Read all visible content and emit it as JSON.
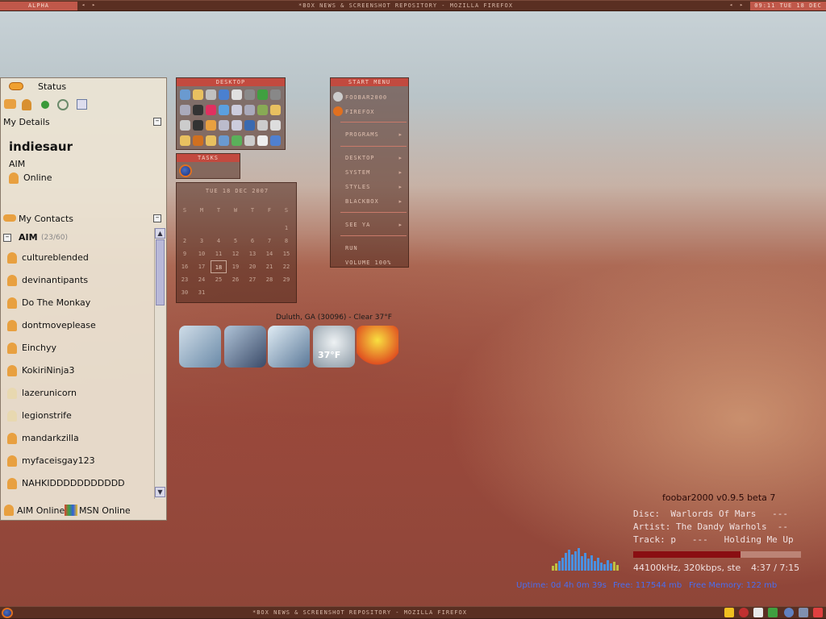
{
  "topbar": {
    "workspace": "ALPHA",
    "title": "*BOX NEWS & SCREENSHOT REPOSITORY - MOZILLA FIREFOX",
    "clock": "09:11 TUE 18 DEC",
    "prev": "◂",
    "next": "▸"
  },
  "bottombar": {
    "title": "*BOX NEWS & SCREENSHOT REPOSITORY - MOZILLA FIREFOX"
  },
  "im": {
    "status_label": "Status",
    "my_details": "My Details",
    "screen_name": "indiesaur",
    "protocol": "AIM",
    "online_status": "Online",
    "my_contacts": "My Contacts",
    "group_name": "AIM",
    "group_count": "(23/60)",
    "contacts": [
      {
        "name": "cultureblended",
        "away": false
      },
      {
        "name": "devinantipants",
        "away": false
      },
      {
        "name": "Do The Monkay",
        "away": false
      },
      {
        "name": "dontmoveplease",
        "away": false
      },
      {
        "name": "Einchyy",
        "away": false
      },
      {
        "name": "KokiriNinja3",
        "away": false
      },
      {
        "name": "lazerunicorn",
        "away": true
      },
      {
        "name": "legionstrife",
        "away": true
      },
      {
        "name": "mandarkzilla",
        "away": false
      },
      {
        "name": "myfaceisgay123",
        "away": false
      },
      {
        "name": "NAHKIDDDDDDDDDDD",
        "away": false
      }
    ],
    "footer_aim": "AIM Online",
    "footer_msn": "MSN Online"
  },
  "desktop_panel": {
    "title": "DESKTOP"
  },
  "tasks_panel": {
    "title": "TASKS"
  },
  "calendar": {
    "header": "TUE 18 DEC 2007",
    "weekdays": [
      "S",
      "M",
      "T",
      "W",
      "T",
      "F",
      "S"
    ],
    "weeks": [
      [
        "",
        "",
        "",
        "",
        "",
        "",
        "1"
      ],
      [
        "2",
        "3",
        "4",
        "5",
        "6",
        "7",
        "8"
      ],
      [
        "9",
        "10",
        "11",
        "12",
        "13",
        "14",
        "15"
      ],
      [
        "16",
        "17",
        "18",
        "19",
        "20",
        "21",
        "22"
      ],
      [
        "23",
        "24",
        "25",
        "26",
        "27",
        "28",
        "29"
      ],
      [
        "30",
        "31",
        "",
        "",
        "",
        "",
        ""
      ]
    ],
    "today": "18"
  },
  "start_menu": {
    "title": "START MENU",
    "items": [
      {
        "label": "FOOBAR2000",
        "arrow": ""
      },
      {
        "label": "FIREFOX",
        "arrow": ""
      },
      {
        "label": "PROGRAMS",
        "arrow": "▸"
      },
      {
        "label": "DESKTOP",
        "arrow": "▸"
      },
      {
        "label": "SYSTEM",
        "arrow": "▸"
      },
      {
        "label": "STYLES",
        "arrow": "▸"
      },
      {
        "label": "BLACKBOX",
        "arrow": "▸"
      },
      {
        "label": "SEE YA",
        "arrow": "▸"
      },
      {
        "label": "RUN",
        "arrow": ""
      },
      {
        "label": "VOLUME 100%",
        "arrow": ""
      }
    ]
  },
  "weather": {
    "caption": "Duluth, GA (30096) - Clear 37°F",
    "temp": "37°F"
  },
  "foobar": {
    "title": "foobar2000 v0.9.5 beta 7",
    "disc": "Disc:  Warlords Of Mars   ---",
    "artist": "Artist: The Dandy Warhols  --",
    "track": "Track: p   ---   Holding Me Up",
    "format": "44100kHz, 320kbps, ste",
    "time": "4:37 / 7:15",
    "progress": 0.64
  },
  "sysinfo": {
    "uptime": "Uptime: 0d 4h 0m 39s",
    "free_disk": "Free: 117544 mb",
    "free_mem": "Free Memory: 122 mb"
  },
  "colors": {
    "accent": "#c24a3f",
    "bar": "#5a2f22",
    "info_text": "#4a6ef0"
  }
}
